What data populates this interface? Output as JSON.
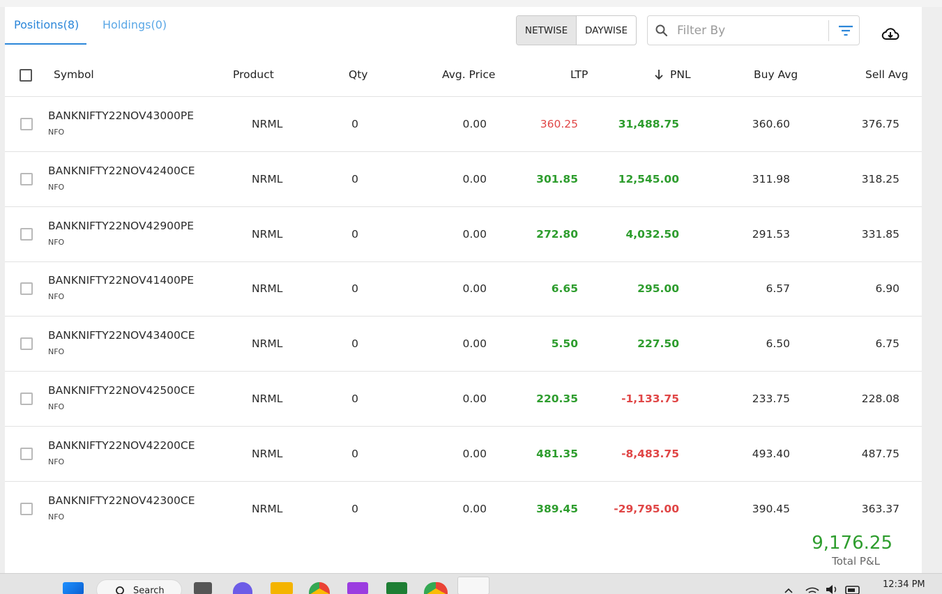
{
  "tabs": [
    {
      "label": "Positions(8)",
      "active": true
    },
    {
      "label": "Holdings(0)",
      "active": false
    }
  ],
  "view_toggle": {
    "netwise": "NETWISE",
    "daywise": "DAYWISE",
    "selected": "NETWISE"
  },
  "filter": {
    "placeholder": "Filter By"
  },
  "columns": {
    "symbol": "Symbol",
    "product": "Product",
    "qty": "Qty",
    "avg_price": "Avg. Price",
    "ltp": "LTP",
    "pnl": "PNL",
    "buy_avg": "Buy Avg",
    "sell_avg": "Sell Avg"
  },
  "rows": [
    {
      "symbol": "BANKNIFTY22NOV43000PE",
      "exchange": "NFO",
      "product": "NRML",
      "qty": "0",
      "avg_price": "0.00",
      "ltp": "360.25",
      "ltp_color": "red",
      "pnl": "31,488.75",
      "pnl_color": "green",
      "buy_avg": "360.60",
      "sell_avg": "376.75"
    },
    {
      "symbol": "BANKNIFTY22NOV42400CE",
      "exchange": "NFO",
      "product": "NRML",
      "qty": "0",
      "avg_price": "0.00",
      "ltp": "301.85",
      "ltp_color": "green",
      "pnl": "12,545.00",
      "pnl_color": "green",
      "buy_avg": "311.98",
      "sell_avg": "318.25"
    },
    {
      "symbol": "BANKNIFTY22NOV42900PE",
      "exchange": "NFO",
      "product": "NRML",
      "qty": "0",
      "avg_price": "0.00",
      "ltp": "272.80",
      "ltp_color": "green",
      "pnl": "4,032.50",
      "pnl_color": "green",
      "buy_avg": "291.53",
      "sell_avg": "331.85"
    },
    {
      "symbol": "BANKNIFTY22NOV41400PE",
      "exchange": "NFO",
      "product": "NRML",
      "qty": "0",
      "avg_price": "0.00",
      "ltp": "6.65",
      "ltp_color": "green",
      "pnl": "295.00",
      "pnl_color": "green",
      "buy_avg": "6.57",
      "sell_avg": "6.90"
    },
    {
      "symbol": "BANKNIFTY22NOV43400CE",
      "exchange": "NFO",
      "product": "NRML",
      "qty": "0",
      "avg_price": "0.00",
      "ltp": "5.50",
      "ltp_color": "green",
      "pnl": "227.50",
      "pnl_color": "green",
      "buy_avg": "6.50",
      "sell_avg": "6.75"
    },
    {
      "symbol": "BANKNIFTY22NOV42500CE",
      "exchange": "NFO",
      "product": "NRML",
      "qty": "0",
      "avg_price": "0.00",
      "ltp": "220.35",
      "ltp_color": "green",
      "pnl": "-1,133.75",
      "pnl_color": "red",
      "buy_avg": "233.75",
      "sell_avg": "228.08"
    },
    {
      "symbol": "BANKNIFTY22NOV42200CE",
      "exchange": "NFO",
      "product": "NRML",
      "qty": "0",
      "avg_price": "0.00",
      "ltp": "481.35",
      "ltp_color": "green",
      "pnl": "-8,483.75",
      "pnl_color": "red",
      "buy_avg": "493.40",
      "sell_avg": "487.75"
    },
    {
      "symbol": "BANKNIFTY22NOV42300CE",
      "exchange": "NFO",
      "product": "NRML",
      "qty": "0",
      "avg_price": "0.00",
      "ltp": "389.45",
      "ltp_color": "green",
      "pnl": "-29,795.00",
      "pnl_color": "red",
      "buy_avg": "390.45",
      "sell_avg": "363.37"
    }
  ],
  "total": {
    "value": "9,176.25",
    "label": "Total P&L"
  },
  "taskbar": {
    "search_label": "Search",
    "clock": "12:34 PM"
  },
  "colors": {
    "accent": "#2b86d9",
    "profit": "#2e9d2e",
    "loss": "#e04646"
  },
  "icons": [
    "search-icon",
    "filter-icon",
    "cloud-download-icon",
    "sort-down-arrow-icon",
    "windows-start-icon",
    "chrome-icon",
    "folder-icon",
    "excel-icon",
    "wifi-icon",
    "volume-icon",
    "battery-icon"
  ]
}
